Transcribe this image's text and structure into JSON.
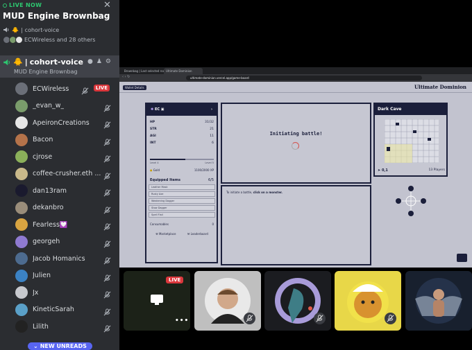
{
  "stage": {
    "live_label": "LIVE NOW",
    "title": "MUD Engine Brownbag",
    "sub_channel": "cohort-voice",
    "others_text": "ECWireless and 28 others"
  },
  "channel": {
    "name": "cohort-voice",
    "subtitle": "MUD Engine Brownbag"
  },
  "members": [
    {
      "name": "ECWireless",
      "live": "LIVE",
      "color": "#6b6f78"
    },
    {
      "name": "_evan_w_",
      "color": "#7a9c6b"
    },
    {
      "name": "ApeironCreations",
      "color": "#e6e6e6"
    },
    {
      "name": "Bacon",
      "color": "#b5734a"
    },
    {
      "name": "cjrose",
      "color": "#8bb05a"
    },
    {
      "name": "coffee-crusher.eth ...",
      "color": "#c9b98a"
    },
    {
      "name": "dan13ram",
      "color": "#1a1a2e"
    },
    {
      "name": "dekanbro",
      "color": "#9a8d7a"
    },
    {
      "name": "Fearless💟",
      "color": "#d9a441"
    },
    {
      "name": "georgeh",
      "color": "#8f7ad1"
    },
    {
      "name": "Jacob Homanics",
      "color": "#4d6b8f"
    },
    {
      "name": "Julien",
      "color": "#3b82c4"
    },
    {
      "name": "Jx",
      "color": "#c7c9ce"
    },
    {
      "name": "KineticSarah",
      "color": "#5aa0c8"
    },
    {
      "name": "Lilith",
      "color": "#222"
    }
  ],
  "unreads_label": "NEW UNREADS",
  "browser": {
    "tabs": [
      "Brownbag | Last selected rooms",
      "Ultimate Dominion"
    ],
    "url": "ultimate-dominion.vercel.app/game-board"
  },
  "game": {
    "wallet_button": "Wallet Details",
    "header_small": "",
    "logo": "Ultimate Dominion",
    "character": {
      "name": "EC",
      "stats": [
        {
          "label": "HP",
          "value": "31/32"
        },
        {
          "label": "STR",
          "value": "21"
        },
        {
          "label": "AGI",
          "value": "11"
        },
        {
          "label": "INT",
          "value": "6"
        }
      ],
      "level_left": "Level 4",
      "level_right": "Level 5",
      "gold_label": "Gold",
      "xp_value": "1100/2000 XP",
      "equipped_label": "Equipped Items",
      "equipped_count": "6/5",
      "items": [
        "Leather Mask",
        "Rusty Axe",
        "Weakening Dagger",
        "Stow Dagger",
        "Spell Flail",
        ""
      ],
      "consumables_label": "Consumables",
      "consumables_value": "0",
      "marketplace": "Marketplace",
      "leaderboard": "Leaderboard"
    },
    "battle_text": "Initiating battle!",
    "log_text_pre": "To initiate a battle, ",
    "log_text_bold": "click on a monster.",
    "map": {
      "title": "Dark Cave",
      "coords": "0,1",
      "players": "13 Players"
    }
  },
  "colors": {
    "accent_green": "#2dc770",
    "live_red": "#da373c",
    "game_navy": "#1b1f3b"
  }
}
